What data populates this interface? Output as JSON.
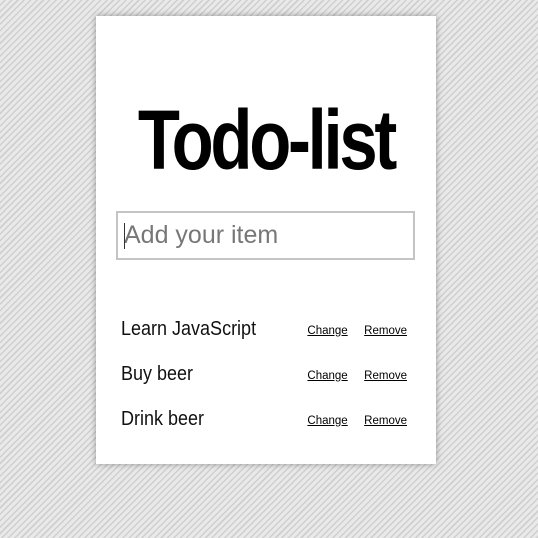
{
  "app": {
    "title": "Todo-list"
  },
  "input": {
    "placeholder": "Add your item",
    "value": ""
  },
  "items": [
    {
      "text": "Learn JavaScript",
      "change_label": "Change",
      "remove_label": "Remove"
    },
    {
      "text": "Buy beer",
      "change_label": "Change",
      "remove_label": "Remove"
    },
    {
      "text": "Drink beer",
      "change_label": "Change",
      "remove_label": "Remove"
    }
  ],
  "colors": {
    "card_background": "#ffffff",
    "title_text": "#000000",
    "input_border": "#c4c4c4",
    "placeholder_text": "#777777",
    "page_background": "#e6e6e6"
  }
}
